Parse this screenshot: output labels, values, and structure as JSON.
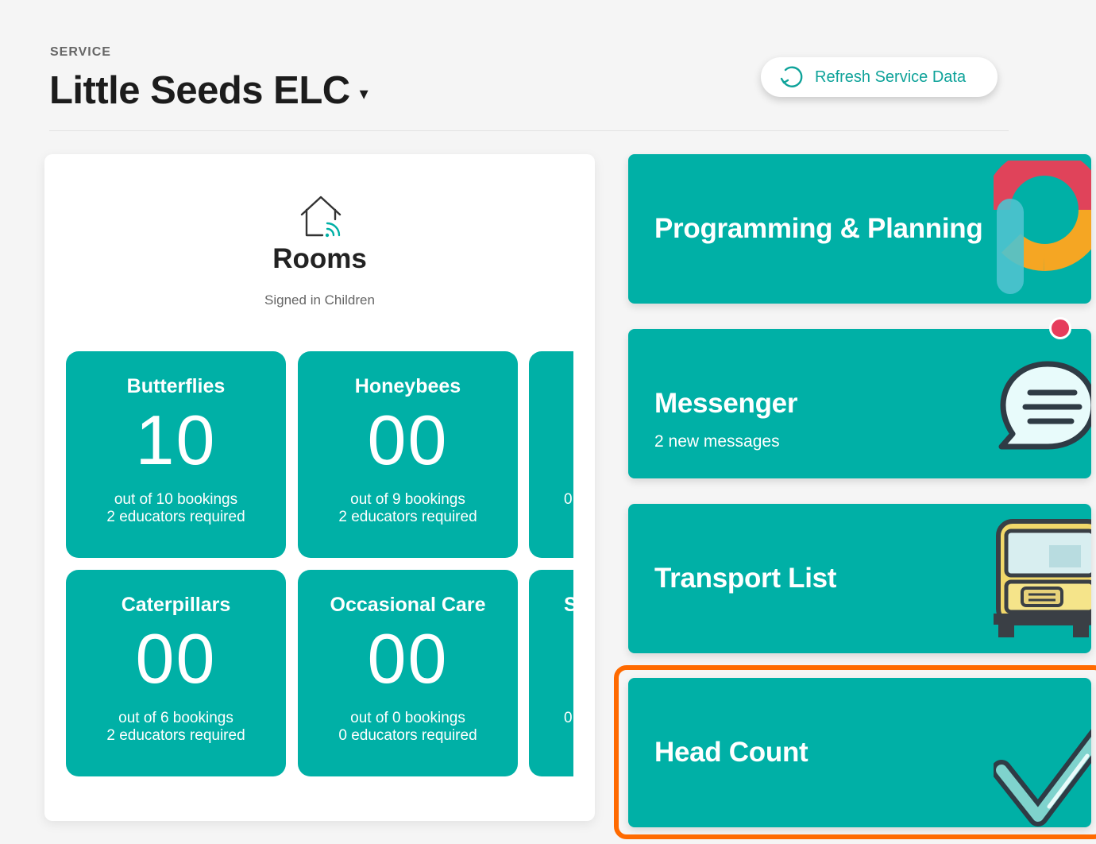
{
  "header": {
    "service_label": "SERVICE",
    "service_name": "Little Seeds ELC",
    "caret": "▾",
    "refresh_label": "Refresh Service Data"
  },
  "rooms": {
    "title": "Rooms",
    "subtitle": "Signed in Children",
    "cards": [
      {
        "name": "Butterflies",
        "count": "10",
        "bookings": "out of 10 bookings",
        "educators": "2 educators required"
      },
      {
        "name": "Honeybees",
        "count": "00",
        "bookings": "out of 9 bookings",
        "educators": "2 educators required"
      },
      {
        "name": "",
        "count": "",
        "bookings": "0",
        "educators": ""
      },
      {
        "name": "Caterpillars",
        "count": "00",
        "bookings": "out of 6 bookings",
        "educators": "2 educators required"
      },
      {
        "name": "Occasional Care",
        "count": "00",
        "bookings": "out of 0 bookings",
        "educators": "0 educators required"
      },
      {
        "name": "S",
        "count": "",
        "bookings": "0",
        "educators": ""
      }
    ]
  },
  "tiles": {
    "planning": {
      "title": "Programming & Planning"
    },
    "messenger": {
      "title": "Messenger",
      "subtitle": "2 new messages"
    },
    "transport": {
      "title": "Transport List"
    },
    "headcount": {
      "title": "Head Count"
    }
  },
  "colors": {
    "teal": "#00b0a6",
    "accent_text": "#0fa39a",
    "notification": "#e63c5c",
    "highlight": "#ff6a00"
  },
  "icons": {
    "rooms": "house-wifi-icon",
    "refresh": "refresh-icon",
    "planning": "programming-logo-icon",
    "messenger": "chat-bubble-icon",
    "transport": "bus-icon",
    "headcount": "checkmark-icon"
  }
}
